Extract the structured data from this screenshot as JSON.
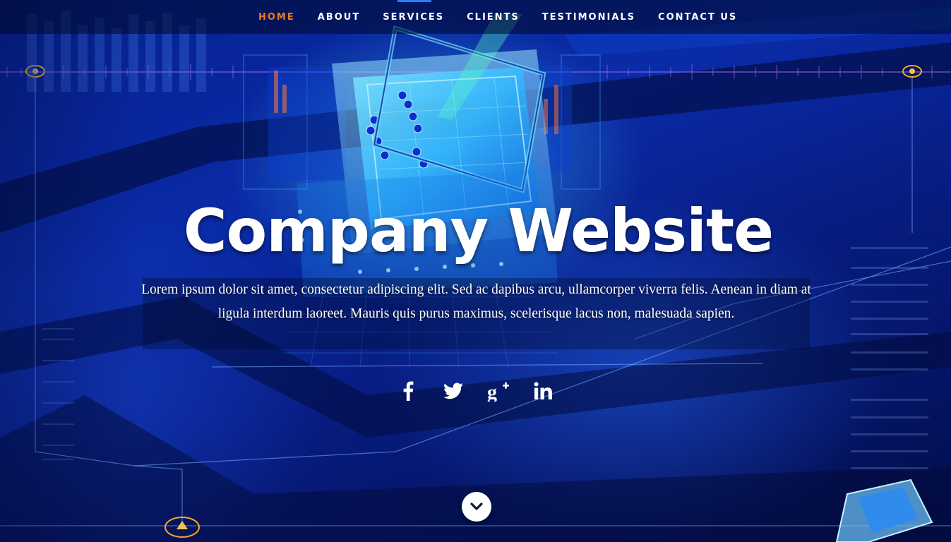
{
  "nav": {
    "items": [
      {
        "label": "HOME",
        "active": true
      },
      {
        "label": "ABOUT",
        "active": false
      },
      {
        "label": "SERVICES",
        "active": false
      },
      {
        "label": "CLIENTS",
        "active": false
      },
      {
        "label": "TESTIMONIALS",
        "active": false
      },
      {
        "label": "CONTACT US",
        "active": false
      }
    ],
    "active_color": "#f07a1c"
  },
  "hero": {
    "title": "Company Website",
    "text": "Lorem ipsum dolor sit amet, consectetur adipiscing elit. Sed ac dapibus arcu, ullamcorper viverra felis. Aenean in diam at ligula interdum laoreet. Mauris quis purus maximus, scelerisque lacus non, malesuada sapien."
  },
  "social": [
    {
      "icon": "facebook-icon"
    },
    {
      "icon": "twitter-icon"
    },
    {
      "icon": "google-plus-icon"
    },
    {
      "icon": "linkedin-icon"
    }
  ],
  "scroll_button": {
    "icon": "chevron-down-icon"
  },
  "colors": {
    "accent": "#f07a1c",
    "background": "#0a2ba8"
  }
}
